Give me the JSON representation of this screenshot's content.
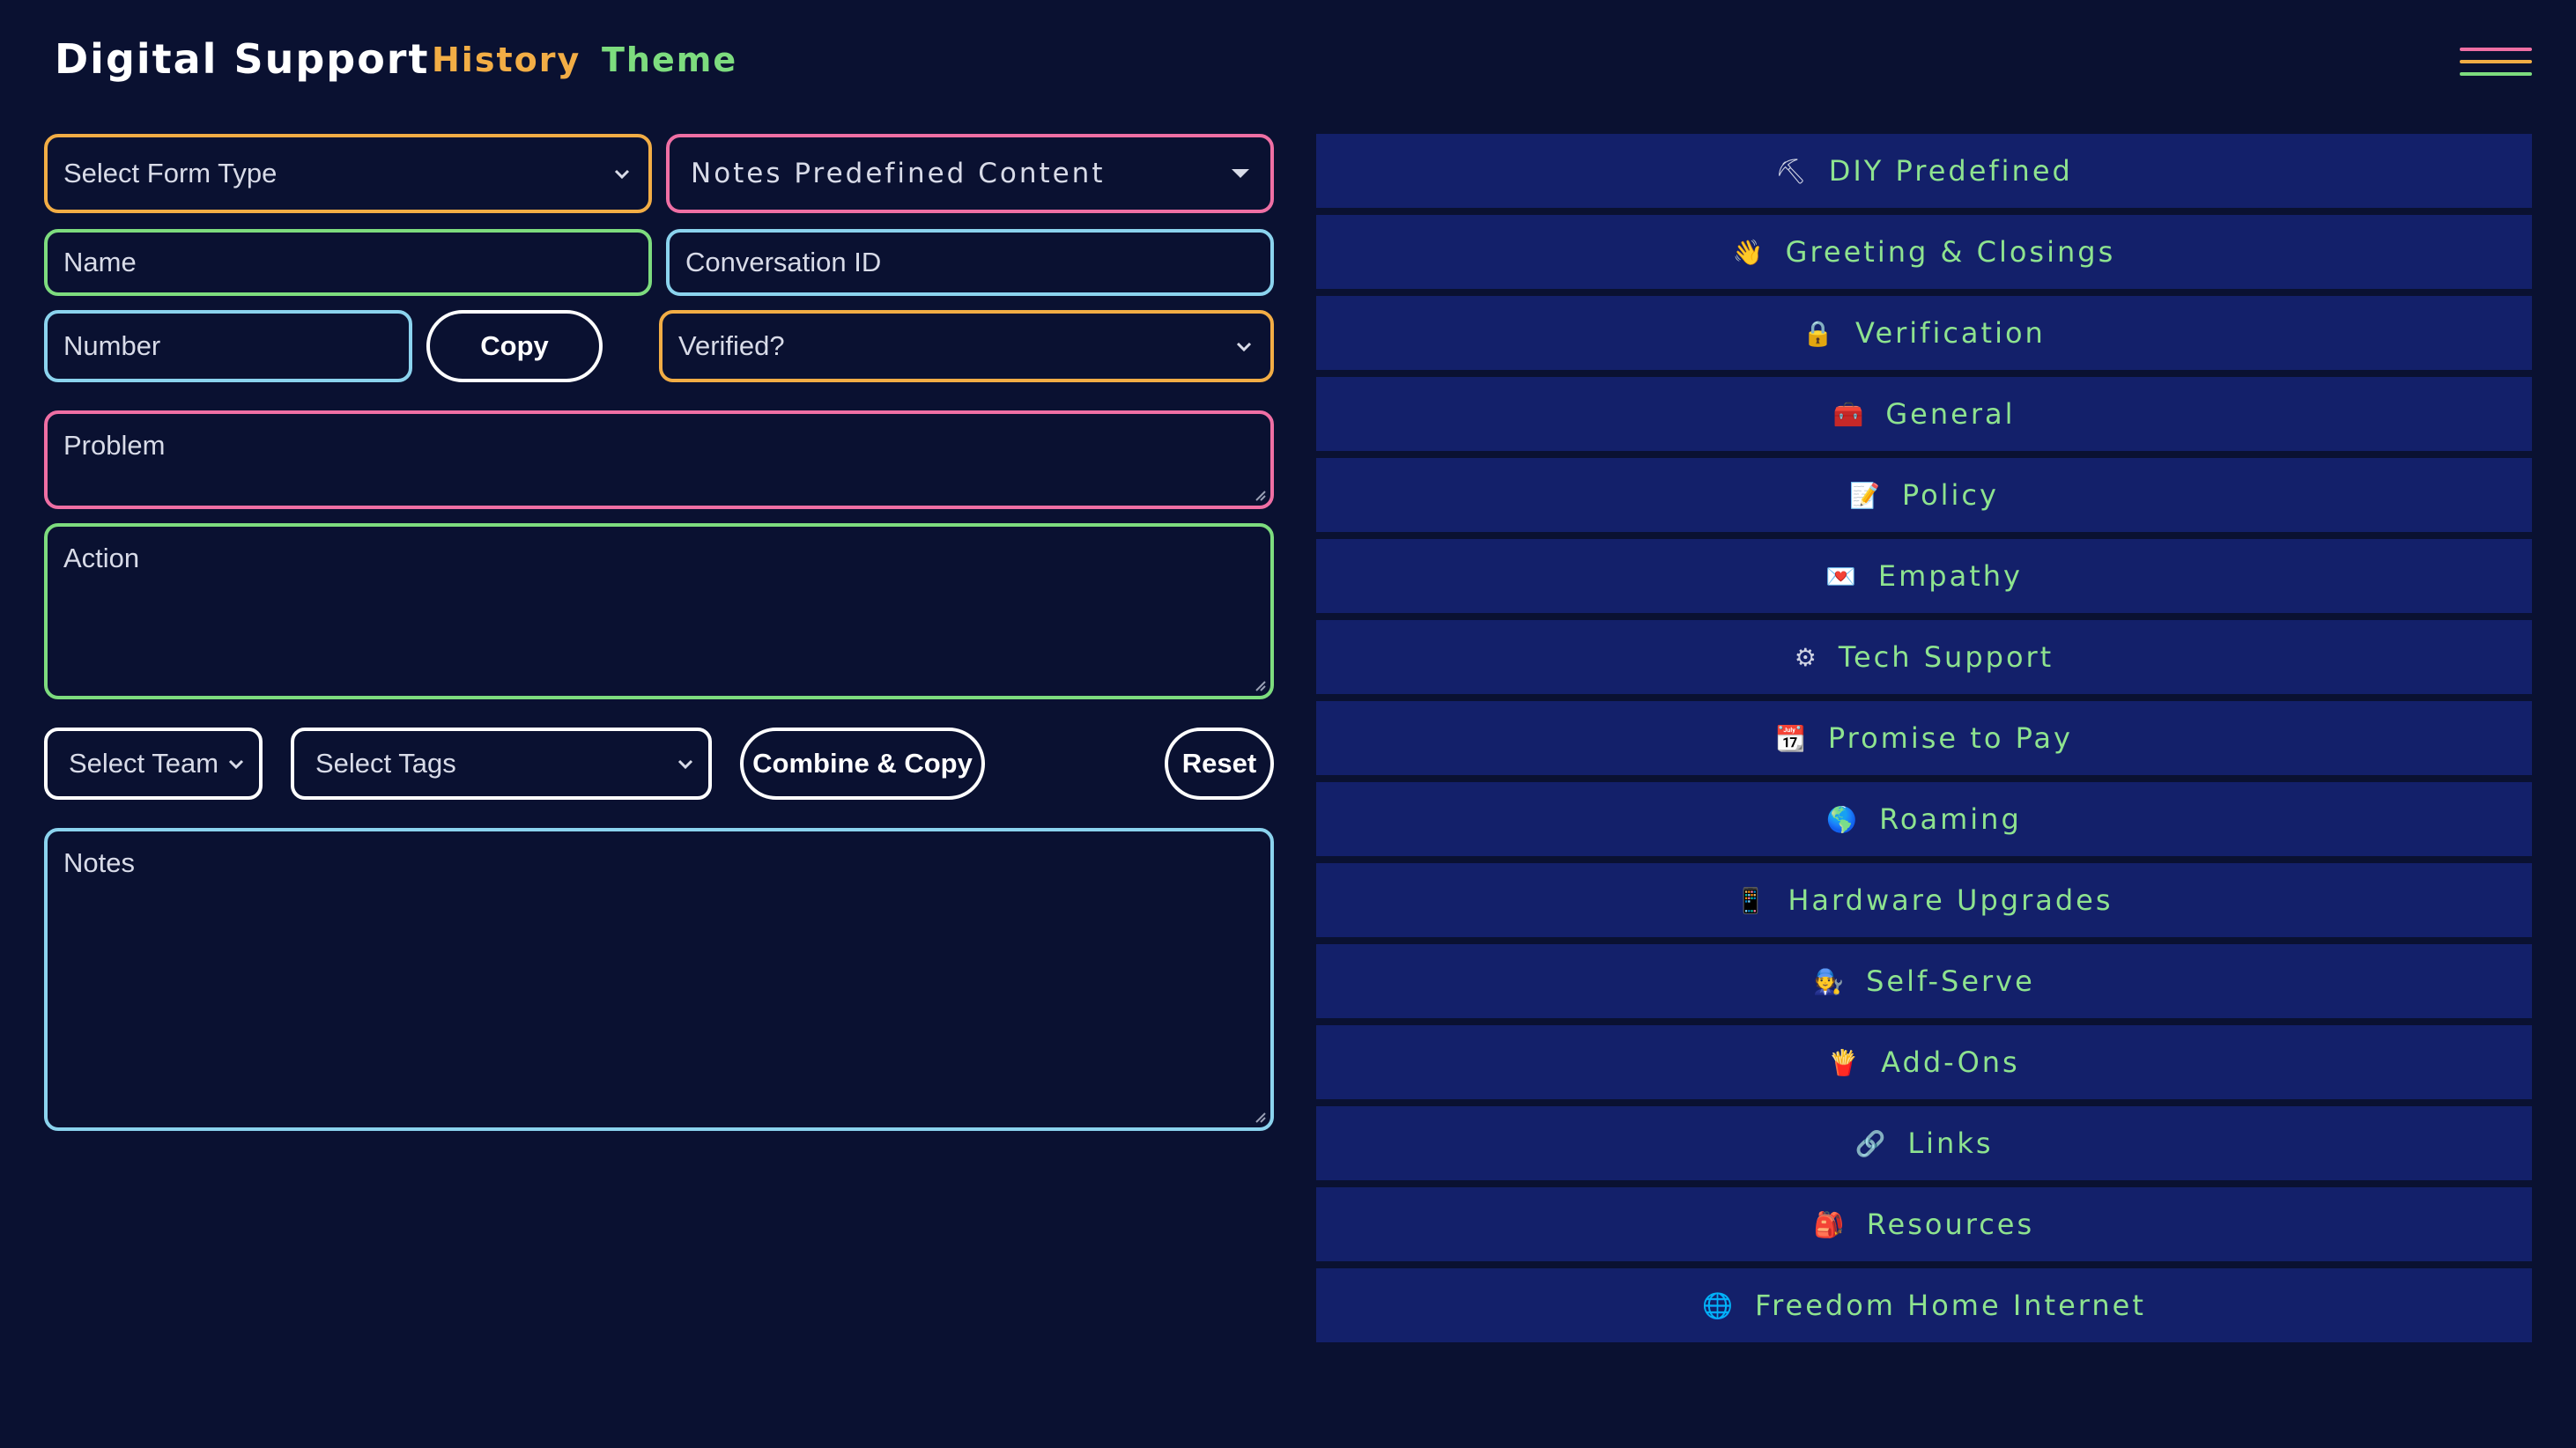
{
  "header": {
    "brand": "Digital Support",
    "nav": [
      {
        "label": "History"
      },
      {
        "label": "Theme"
      }
    ]
  },
  "form": {
    "form_type_select": "Select Form Type",
    "predefined_select": "Notes Predefined Content",
    "name_placeholder": "Name",
    "conversation_placeholder": "Conversation ID",
    "number_placeholder": "Number",
    "copy_label": "Copy",
    "verified_select": "Verified?",
    "problem_placeholder": "Problem",
    "action_placeholder": "Action",
    "team_select": "Select Team",
    "tags_select": "Select Tags",
    "combine_label": "Combine & Copy",
    "reset_label": "Reset",
    "notes_placeholder": "Notes"
  },
  "categories": [
    {
      "icon": "⛏",
      "label": "DIY Predefined"
    },
    {
      "icon": "👋",
      "label": "Greeting & Closings"
    },
    {
      "icon": "🔒",
      "label": "Verification"
    },
    {
      "icon": "🧰",
      "label": "General"
    },
    {
      "icon": "📝",
      "label": "Policy"
    },
    {
      "icon": "💌",
      "label": "Empathy"
    },
    {
      "icon": "⚙",
      "label": "Tech Support"
    },
    {
      "icon": "📆",
      "label": "Promise to Pay"
    },
    {
      "icon": "🌎",
      "label": "Roaming"
    },
    {
      "icon": "📱",
      "label": "Hardware Upgrades"
    },
    {
      "icon": "🧑‍🔧",
      "label": "Self-Serve"
    },
    {
      "icon": "🍟",
      "label": "Add-Ons"
    },
    {
      "icon": "🔗",
      "label": "Links"
    },
    {
      "icon": "🎒",
      "label": "Resources"
    },
    {
      "icon": "🌐",
      "label": "Freedom Home Internet"
    }
  ],
  "colors": {
    "background": "#0a1131",
    "panel_item": "#13206a",
    "accent_orange": "#f2ad45",
    "accent_green": "#7ddc7e",
    "accent_pink": "#ef6fa4",
    "accent_blue": "#8bd3ee"
  }
}
